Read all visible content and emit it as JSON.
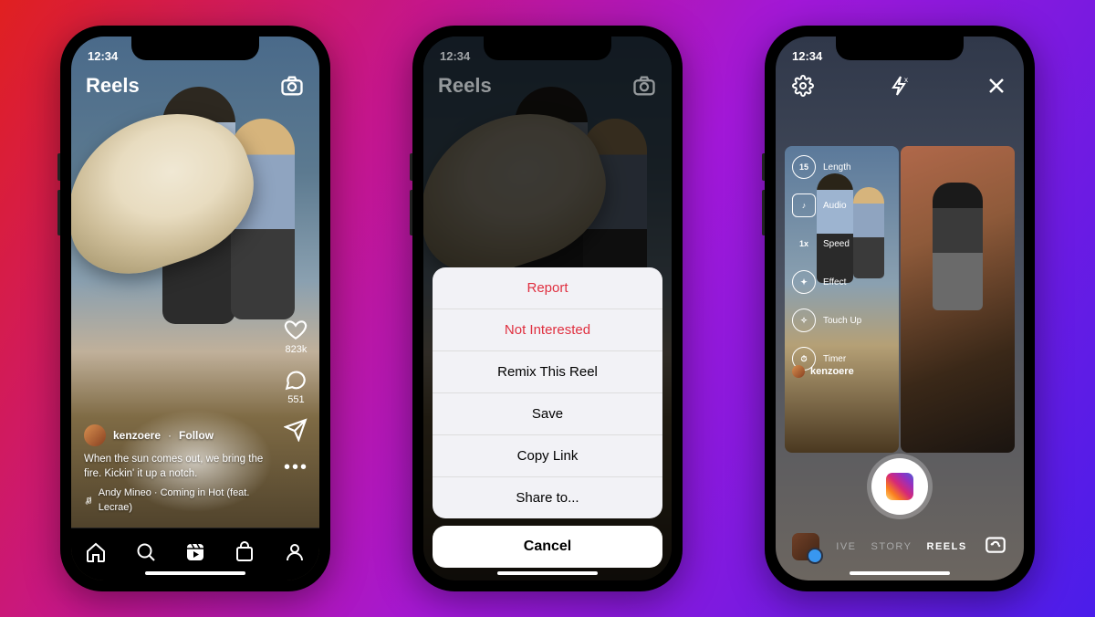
{
  "status": {
    "time": "12:34"
  },
  "reel": {
    "title": "Reels",
    "likes": "823k",
    "comments": "551",
    "username": "kenzoere",
    "separator": "·",
    "follow": "Follow",
    "caption": "When the sun comes out, we bring the fire. Kickin' it up a notch.",
    "audio": "Andy Mineo · Coming in Hot (feat. Lecrae)",
    "more": "•••"
  },
  "sheet": {
    "report": "Report",
    "not_interested": "Not Interested",
    "remix": "Remix This Reel",
    "save": "Save",
    "copy": "Copy Link",
    "share": "Share to...",
    "cancel": "Cancel"
  },
  "camera": {
    "tools": {
      "length_val": "15",
      "length": "Length",
      "audio": "Audio",
      "speed_val": "1x",
      "speed": "Speed",
      "effect": "Effect",
      "touchup": "Touch Up",
      "timer": "Timer"
    },
    "username": "kenzoere",
    "modes": {
      "live": "IVE",
      "story": "STORY",
      "reels": "REELS"
    }
  }
}
